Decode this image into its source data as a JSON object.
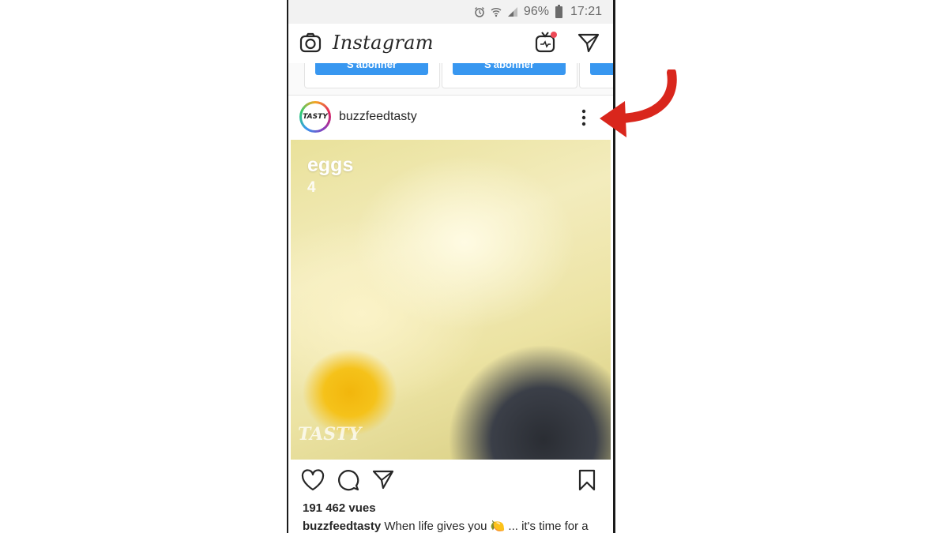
{
  "status": {
    "battery": "96%",
    "time": "17:21"
  },
  "app": {
    "title": "Instagram"
  },
  "suggestions": {
    "button_label": "S'abonner"
  },
  "post": {
    "username": "buzzfeedtasty",
    "avatar_text": "TASTY",
    "media_caption_title": "eggs",
    "media_caption_number": "4",
    "watermark": "TASTY",
    "views": "191 462 vues",
    "caption_user": "buzzfeedtasty",
    "caption_text": " When life gives you 🍋 ... it's time for a"
  },
  "colors": {
    "accent": "#3897f0",
    "annotation_arrow": "#d9261c"
  }
}
